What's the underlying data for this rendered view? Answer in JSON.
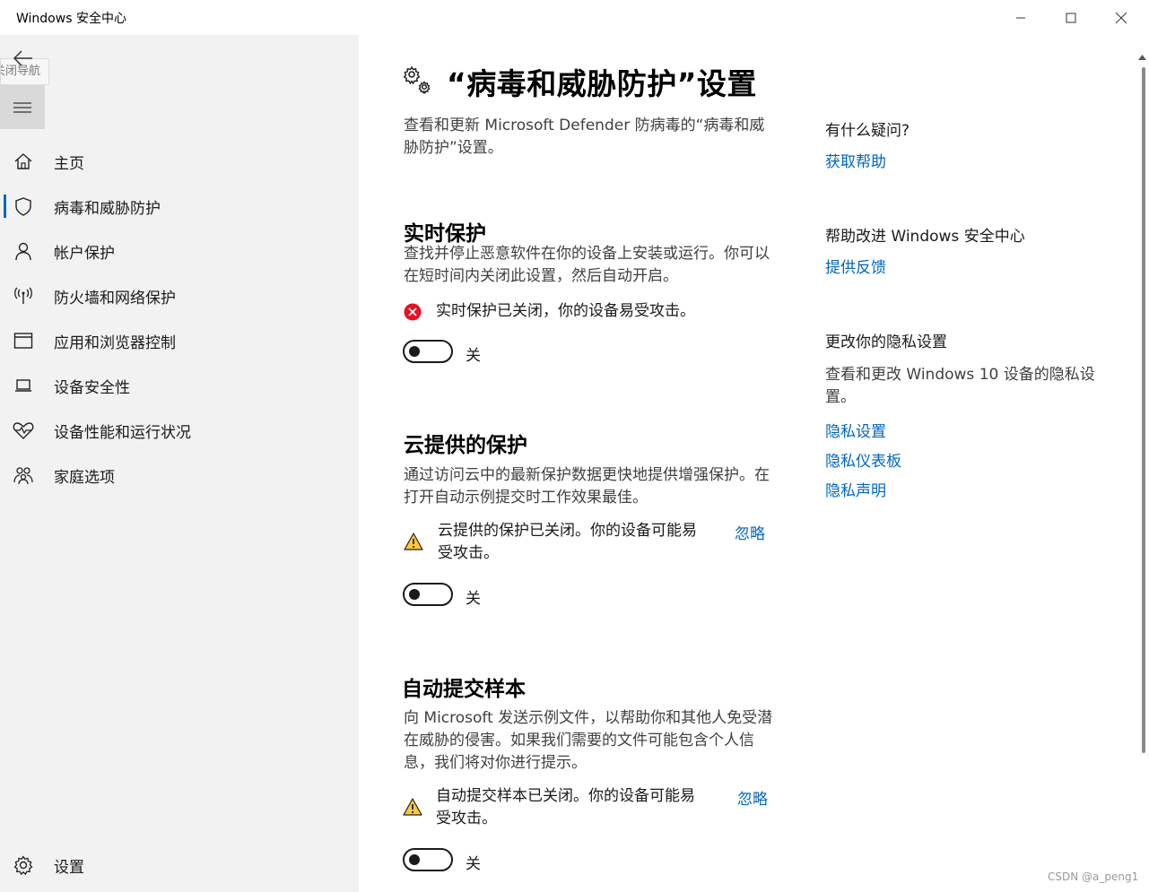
{
  "window": {
    "title": "Windows 安全中心",
    "controls": [
      "minimize",
      "maximize",
      "close"
    ]
  },
  "sidebar": {
    "tooltip": "关闭导航",
    "items": [
      {
        "label": "主页",
        "icon": "home-icon"
      },
      {
        "label": "病毒和威胁防护",
        "icon": "shield-icon",
        "active": true
      },
      {
        "label": "帐户保护",
        "icon": "person-icon"
      },
      {
        "label": "防火墙和网络保护",
        "icon": "wifi-icon"
      },
      {
        "label": "应用和浏览器控制",
        "icon": "browser-window-icon"
      },
      {
        "label": "设备安全性",
        "icon": "laptop-icon"
      },
      {
        "label": "设备性能和运行状况",
        "icon": "heart-pulse-icon"
      },
      {
        "label": "家庭选项",
        "icon": "family-icon"
      }
    ],
    "settings_label": "设置"
  },
  "main": {
    "title": "“病毒和威胁防护”设置",
    "description": "查看和更新 Microsoft Defender 防病毒的“病毒和威胁防护”设置。",
    "sections": [
      {
        "title": "实时保护",
        "description": "查找并停止恶意软件在你的设备上安装或运行。你可以在短时间内关闭此设置，然后自动开启。",
        "status": "实时保护已关闭，你的设备易受攻击。",
        "status_kind": "error",
        "toggle_label": "关",
        "toggle_on": false
      },
      {
        "title": "云提供的保护",
        "description": "通过访问云中的最新保护数据更快地提供增强保护。在打开自动示例提交时工作效果最佳。",
        "status": "云提供的保护已关闭。你的设备可能易受攻击。",
        "status_kind": "warning",
        "dismiss": "忽略",
        "toggle_label": "关",
        "toggle_on": false
      },
      {
        "title": "自动提交样本",
        "description": "向 Microsoft 发送示例文件，以帮助你和其他人免受潜在威胁的侵害。如果我们需要的文件可能包含个人信息，我们将对你进行提示。",
        "status": "自动提交样本已关闭。你的设备可能易受攻击。",
        "status_kind": "warning",
        "dismiss": "忽略",
        "toggle_label": "关",
        "toggle_on": false
      }
    ]
  },
  "aside": {
    "question_heading": "有什么疑问?",
    "help_link": "获取帮助",
    "improve_heading": "帮助改进 Windows 安全中心",
    "feedback_link": "提供反馈",
    "privacy_heading": "更改你的隐私设置",
    "privacy_text": "查看和更改 Windows 10 设备的隐私设置。",
    "privacy_links": [
      "隐私设置",
      "隐私仪表板",
      "隐私声明"
    ]
  },
  "colors": {
    "accent": "#0067c0",
    "error": "#e81123",
    "warning": "#ffc83d",
    "sidebar_bg": "#f2f2f2"
  },
  "watermark": "CSDN @a_peng1"
}
